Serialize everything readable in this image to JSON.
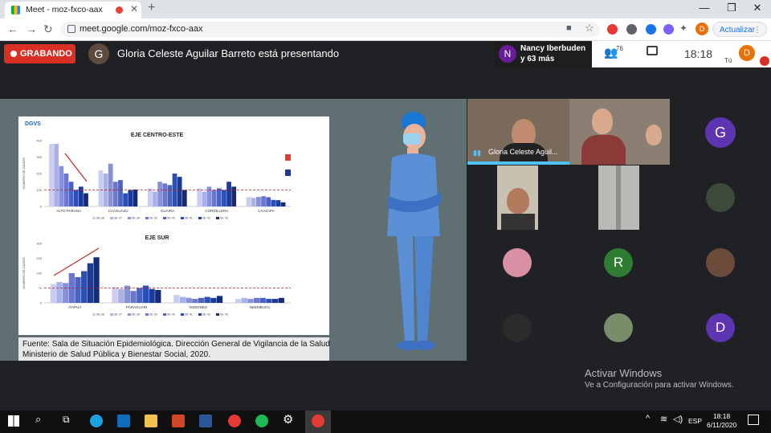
{
  "browser": {
    "tab_title": "Meet - moz-fxco-aax",
    "url": "meet.google.com/moz-fxco-aax",
    "update_label": "Actualizar",
    "profile_initial": "D"
  },
  "meet": {
    "recording_label": "GRABANDO",
    "presenter_initial": "G",
    "presenting_text": "Gloria Celeste Aguilar Barreto está presentando",
    "nancy_initial": "N",
    "participants_line1": "Nancy Iberbuden",
    "participants_line2": "y 63 más",
    "people_count": "76",
    "clock": "18:18",
    "you_label": "Tú",
    "you_initial": "D",
    "speaker_name": "Gloria Celeste Aguil...",
    "tile_initials": [
      "G",
      "R",
      "D"
    ]
  },
  "slide": {
    "logo": "DGVS",
    "source_line1": "Fuente: Sala de Situación Epidemiológica. Dirección General de Vigilancia de la Salud",
    "source_line2": "Ministerio de Salud Pública y Bienestar Social, 2020.",
    "ylabel": "NUMERO DE CASOS"
  },
  "chart_data": [
    {
      "type": "bar",
      "title": "EJE CENTRO-ESTE",
      "ylabel": "NUMERO DE CASOS",
      "ylim": [
        0,
        400
      ],
      "categories": [
        "ALTO PARANA",
        "CAAGUAZU",
        "GUAIRA",
        "CORDILLERA",
        "CAAZAPA"
      ],
      "legend": [
        "SE 36",
        "SE 37",
        "SE 38",
        "SE 39",
        "SE 40",
        "SE 41",
        "SE 42",
        "SE 43"
      ],
      "series_values": [
        [
          380,
          380,
          245,
          200,
          150,
          100,
          120,
          80
        ],
        [
          220,
          200,
          260,
          150,
          160,
          80,
          100,
          103
        ],
        [
          110,
          90,
          150,
          140,
          130,
          200,
          180,
          100
        ],
        [
          110,
          90,
          120,
          100,
          110,
          100,
          150,
          120
        ],
        [
          57,
          52,
          58,
          62,
          56,
          40,
          38,
          25
        ]
      ],
      "colors": [
        "#c9cef0",
        "#aab1e6",
        "#8890d8",
        "#6c76cc",
        "#4a63c2",
        "#2a4fb6",
        "#1c3a99",
        "#132b78"
      ]
    },
    {
      "type": "bar",
      "title": "EJE SUR",
      "ylabel": "NUMERO DE CASOS",
      "ylim": [
        0,
        300
      ],
      "categories": [
        "ITAPUA",
        "PARAGUARI",
        "MISIONES",
        "NEEMBUCU"
      ],
      "legend": [
        "SE 36",
        "SE 37",
        "SE 38",
        "SE 39",
        "SE 40",
        "SE 41",
        "SE 42",
        "SE 43"
      ],
      "series_values": [
        [
          95,
          105,
          100,
          150,
          130,
          160,
          200,
          230
        ],
        [
          80,
          70,
          87,
          60,
          75,
          87,
          70,
          65
        ],
        [
          40,
          30,
          25,
          20,
          25,
          30,
          25,
          35
        ],
        [
          20,
          25,
          20,
          25,
          25,
          20,
          20,
          25
        ]
      ],
      "colors": [
        "#c9cef0",
        "#aab1e6",
        "#8890d8",
        "#6c76cc",
        "#4a63c2",
        "#2a4fb6",
        "#1c3a99",
        "#132b78"
      ]
    }
  ],
  "watermark": {
    "line1": "Activar Windows",
    "line2": "Ve a Configuración para activar Windows."
  },
  "taskbar": {
    "time": "18:18",
    "date": "6/11/2020",
    "lang": "ESP"
  }
}
